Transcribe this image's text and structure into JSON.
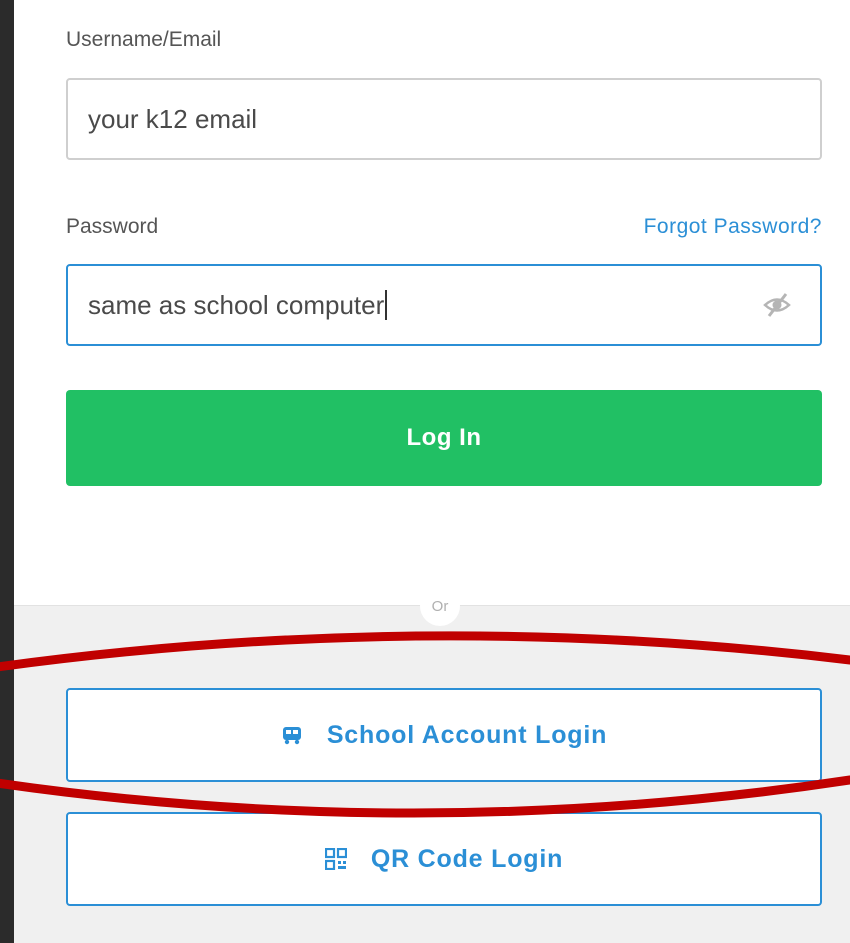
{
  "form": {
    "username_label": "Username/Email",
    "username_value": "your k12 email",
    "password_label": "Password",
    "forgot_link": "Forgot Password?",
    "password_value": "same as school computer",
    "password_toggle_icon": "eye-slash-icon",
    "login_button": "Log In"
  },
  "divider": {
    "or_text": "Or"
  },
  "alternatives": {
    "school_login": {
      "label": "School Account Login",
      "icon": "bus-icon"
    },
    "qr_login": {
      "label": "QR Code Login",
      "icon": "qr-code-icon"
    }
  },
  "colors": {
    "accent_blue": "#2b8fd6",
    "login_green": "#21c064",
    "annotation_red": "#c00000",
    "frame_dark": "#2b2b2b"
  }
}
